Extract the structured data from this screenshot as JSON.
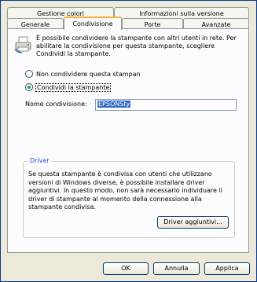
{
  "tabs_row1": [
    {
      "label": "Gestione colori"
    },
    {
      "label": "Informazioni sulla versione"
    }
  ],
  "tabs_row2": [
    {
      "label": "Generale"
    },
    {
      "label": "Condivisione",
      "active": true
    },
    {
      "label": "Porte"
    },
    {
      "label": "Avanzate"
    }
  ],
  "sharing": {
    "description": "È possibile condividere la stampante con altri utenti in rete. Per abilitare la condivisione per questa stampante, scegliere Condividi la stampante.",
    "not_share_label": "Non condividere questa stampan",
    "share_label": "Condividi la stampante",
    "share_name_label": "Nome condivisione:",
    "share_name_value": "EPSONSty"
  },
  "driver": {
    "group_title": "Driver",
    "text": "Se questa stampante è condivisa con utenti che utilizzano versioni di Windows diverse, è possibile installare driver aggiuntivi. In questo modo, non sarà necessario individuare il driver di stampante al momento della connessione alla stampante condivisa.",
    "additional_button": "Driver aggiuntivi..."
  },
  "footer": {
    "ok": "OK",
    "cancel": "Annulla",
    "apply": "Applica"
  },
  "colors": {
    "accent": "#f3b23b",
    "frame": "#0b3b8c",
    "selection": "#316ac5"
  }
}
